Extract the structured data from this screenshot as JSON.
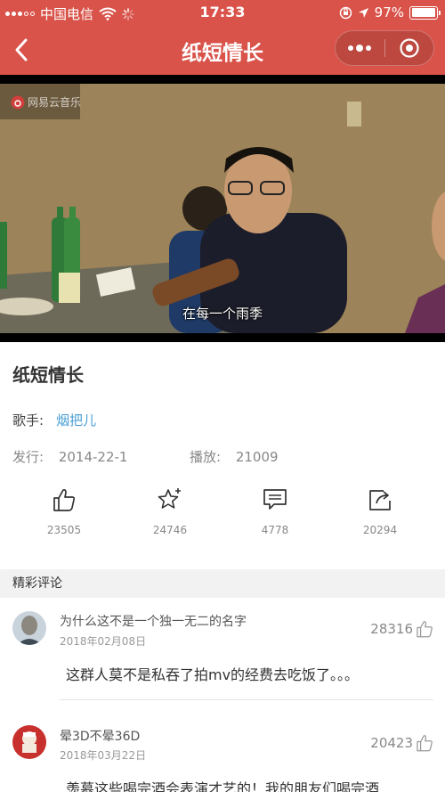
{
  "status_bar": {
    "carrier": "中国电信",
    "time": "17:33",
    "battery": "97%",
    "battery_level": 0.97
  },
  "nav": {
    "title": "纸短情长",
    "back_icon": "chevron-left-icon",
    "more_icon": "more-dots-icon",
    "close_icon": "target-circle-icon",
    "color": "#d9534a"
  },
  "video": {
    "watermark": "网易云音乐",
    "subtitle": "在每一个雨季"
  },
  "song": {
    "title": "纸短情长",
    "artist_label": "歌手:",
    "artist": "烟把儿",
    "release_label": "发行:",
    "release_date": "2014-22-1",
    "plays_label": "播放:",
    "plays": "21009"
  },
  "actions": [
    {
      "icon": "thumbs-up-icon",
      "count": "23505"
    },
    {
      "icon": "star-plus-icon",
      "count": "24746"
    },
    {
      "icon": "comment-icon",
      "count": "4778"
    },
    {
      "icon": "share-icon",
      "count": "20294"
    }
  ],
  "comments_section": {
    "title": "精彩评论",
    "items": [
      {
        "user": "为什么这不是一个独一无二的名字",
        "date": "2018年02月08日",
        "likes": "28316",
        "text": "这群人莫不是私吞了拍mv的经费去吃饭了。。。"
      },
      {
        "user": "晕3D不晕36D",
        "date": "2018年03月22日",
        "likes": "20423",
        "text": "羡慕这些喝完酒会表演才艺的！我的朋友们喝完酒"
      }
    ]
  },
  "colors": {
    "accent": "#d9534a",
    "link": "#4a9fd4"
  }
}
